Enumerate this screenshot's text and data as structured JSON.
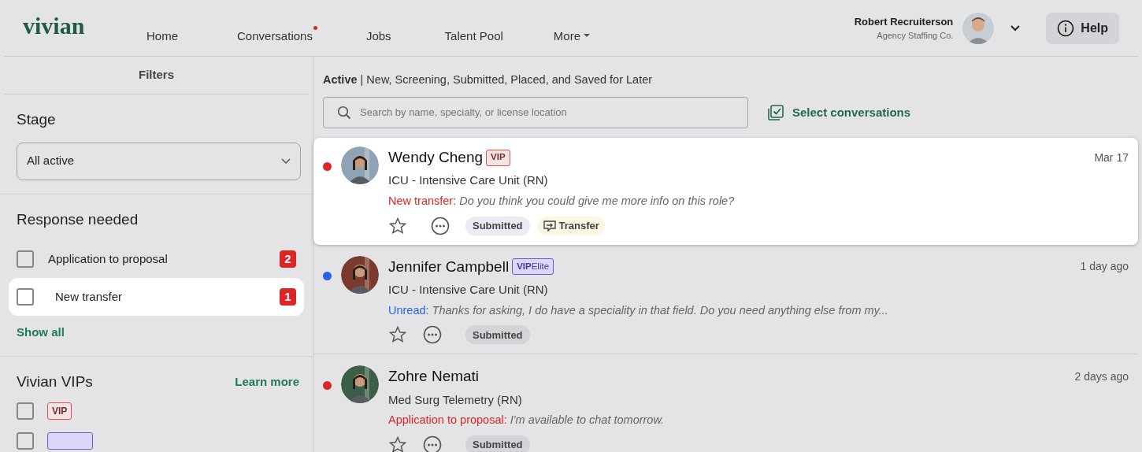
{
  "logo": "vivian",
  "nav": [
    {
      "label": "Home",
      "notify": false
    },
    {
      "label": "Conversations",
      "notify": true
    },
    {
      "label": "Jobs",
      "notify": false
    },
    {
      "label": "Talent Pool",
      "notify": false
    },
    {
      "label": "More",
      "notify": false,
      "kind": "menu"
    }
  ],
  "user": {
    "name": "Robert Recruiterson",
    "company": "Agency Staffing Co."
  },
  "help": "Help",
  "filters": {
    "title": "Filters",
    "stage": {
      "heading": "Stage",
      "value": "All active"
    },
    "response_needed": {
      "heading": "Response needed",
      "items": [
        {
          "label": "Application to proposal",
          "count": "2",
          "checked": false,
          "selected": false
        },
        {
          "label": "New transfer",
          "count": "1",
          "checked": false,
          "selected": true
        }
      ],
      "show_all": "Show all"
    },
    "vips": {
      "heading": "Vivian VIPs",
      "learn_more": "Learn more",
      "items": [
        {
          "kind": "vip",
          "badge": "VIP",
          "checked": false
        },
        {
          "kind": "vip_elite",
          "checked": false
        }
      ]
    }
  },
  "list": {
    "status": "**Active** | New, Screening, Submitted, Placed, and Saved for Later",
    "search": {
      "placeholder": "Search by name, specialty, or license location"
    },
    "select": "Select conversations",
    "conversations": [
      {
        "name": "Wendy Cheng",
        "badge": {
          "kind": "vip",
          "text": "VIP"
        },
        "role": "ICU - Intensive Care Unit (RN)",
        "label": "New transfer:",
        "message": "Do you think you could give me more info on this role?",
        "date": "Mar 17",
        "color": "#dc2626",
        "selected": true,
        "starred": false,
        "tags": [
          {
            "kind": "stage",
            "text": "Submitted"
          },
          {
            "kind": "transfer",
            "text": "Transfer"
          }
        ]
      },
      {
        "name": "Jennifer Campbell",
        "badge": {
          "kind": "vip_elite",
          "text": "**VIP**Elite"
        },
        "role": "ICU - Intensive Care Unit (RN)",
        "label": "Unread:",
        "message": "Thanks for asking, I do have a speciality in that field. Do you need anything else from my...",
        "date": "1 day ago",
        "color": "#2563eb",
        "selected": false,
        "starred": false,
        "tags": [
          {
            "kind": "stage",
            "text": "Submitted"
          }
        ]
      },
      {
        "name": "Zohre Nemati",
        "role": "Med Surg Telemetry (RN)",
        "label": "Application to proposal:",
        "message": "I'm available to chat tomorrow.",
        "date": "2 days ago",
        "color": "#dc2626",
        "selected": false,
        "starred": false,
        "tags": [
          {
            "kind": "stage",
            "text": "Submitted"
          }
        ]
      }
    ]
  }
}
